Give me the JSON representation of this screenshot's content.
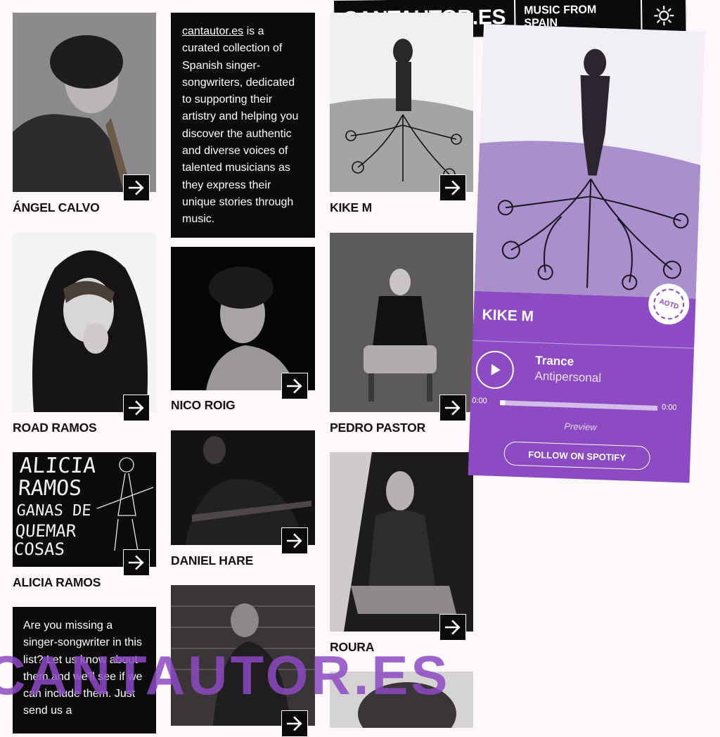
{
  "header": {
    "logo": "CANTAUTOR.ES",
    "tagline": "MUSIC FROM SPAIN",
    "theme_icon": "sun-icon"
  },
  "intro": {
    "link_text": "cantautor.es",
    "text": " is a curated collection of Spanish singer-songwriters, dedicated to supporting their artistry and helping you discover the authentic and diverse voices of talented musicians as they express their unique stories through music."
  },
  "missing": {
    "text": "Are you missing a singer-songwriter in this list? Let us know about them and we'll see if we can include them. Just send us a"
  },
  "artists": [
    {
      "name": "ÁNGEL CALVO"
    },
    {
      "name": "ROAD RAMOS"
    },
    {
      "name": "ALICIA RAMOS"
    },
    {
      "name": "NICO ROIG"
    },
    {
      "name": "DANIEL HARE"
    },
    {
      "name": "KIKE M"
    },
    {
      "name": "PEDRO PASTOR"
    },
    {
      "name": "ROURA"
    }
  ],
  "album_cover_text": {
    "line1": "ALICIA",
    "line2": "RAMOS",
    "line3": "GANAS DE",
    "line4": "QUEMAR",
    "line5": "COSAS"
  },
  "player": {
    "artist": "KIKE M",
    "track": "Trance",
    "album": "Antipersonal",
    "time_current": "0:00",
    "time_total": "0:00",
    "progress": 0.03,
    "preview_label": "Preview",
    "follow_label": "FOLLOW ON SPOTIFY",
    "badge": "AOTD",
    "accent": "#8c4ac3"
  },
  "watermark": "CANTAUTOR.ES",
  "colors": {
    "background": "#fdf8fc",
    "dark": "#0d0a0e",
    "purple": "#8c4ac3"
  }
}
